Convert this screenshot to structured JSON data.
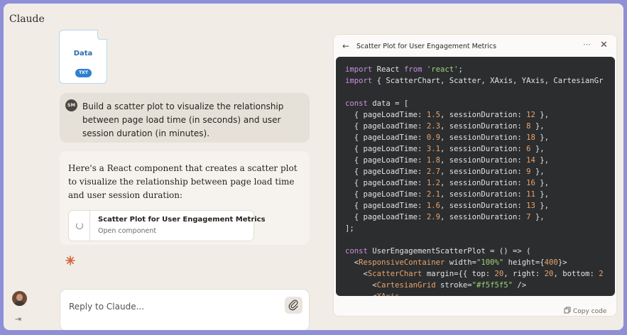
{
  "app": {
    "title": "Claude"
  },
  "file": {
    "name": "Data",
    "badge": "TXT"
  },
  "user_message": {
    "initials": "SM",
    "text": "Build a scatter plot to visualize the relationship between page load time (in seconds) and user session duration (in minutes)."
  },
  "assistant_message": {
    "text": "Here's a React component that creates a scatter plot to visualize the relationship between page load time and user session duration:"
  },
  "artifact_chip": {
    "title": "Scatter Plot for User Engagement Metrics",
    "subtitle": "Open component"
  },
  "reply": {
    "placeholder": "Reply to Claude..."
  },
  "artifact_panel": {
    "title": "Scatter Plot for User Engagement Metrics",
    "more": "⋯",
    "close": "✕",
    "back": "←",
    "copy_label": "Copy code",
    "code_lines": [
      "import React from 'react';",
      "import { ScatterChart, Scatter, XAxis, YAxis, CartesianGr",
      "",
      "const data = [",
      "  { pageLoadTime: 1.5, sessionDuration: 12 },",
      "  { pageLoadTime: 2.3, sessionDuration: 8 },",
      "  { pageLoadTime: 0.9, sessionDuration: 18 },",
      "  { pageLoadTime: 3.1, sessionDuration: 6 },",
      "  { pageLoadTime: 1.8, sessionDuration: 14 },",
      "  { pageLoadTime: 2.7, sessionDuration: 9 },",
      "  { pageLoadTime: 1.2, sessionDuration: 16 },",
      "  { pageLoadTime: 2.1, sessionDuration: 11 },",
      "  { pageLoadTime: 1.6, sessionDuration: 13 },",
      "  { pageLoadTime: 2.9, sessionDuration: 7 },",
      "];",
      "",
      "const UserEngagementScatterPlot = () => (",
      "  <ResponsiveContainer width=\"100%\" height={400}>",
      "    <ScatterChart margin={{ top: 20, right: 20, bottom: 2",
      "      <CartesianGrid stroke=\"#f5f5f5\" />",
      "      <XAxis"
    ]
  },
  "icons": {
    "loader": "loader-icon",
    "spark": "claude-spark-icon",
    "attach": "paperclip-icon",
    "sidebar": "sidebar-expand-icon",
    "copy": "copy-icon"
  },
  "colors": {
    "accent": "#d3643b",
    "file_badge": "#2f7fd1",
    "code_bg": "#2c2d2f",
    "frame_border": "#8f8fd8"
  }
}
